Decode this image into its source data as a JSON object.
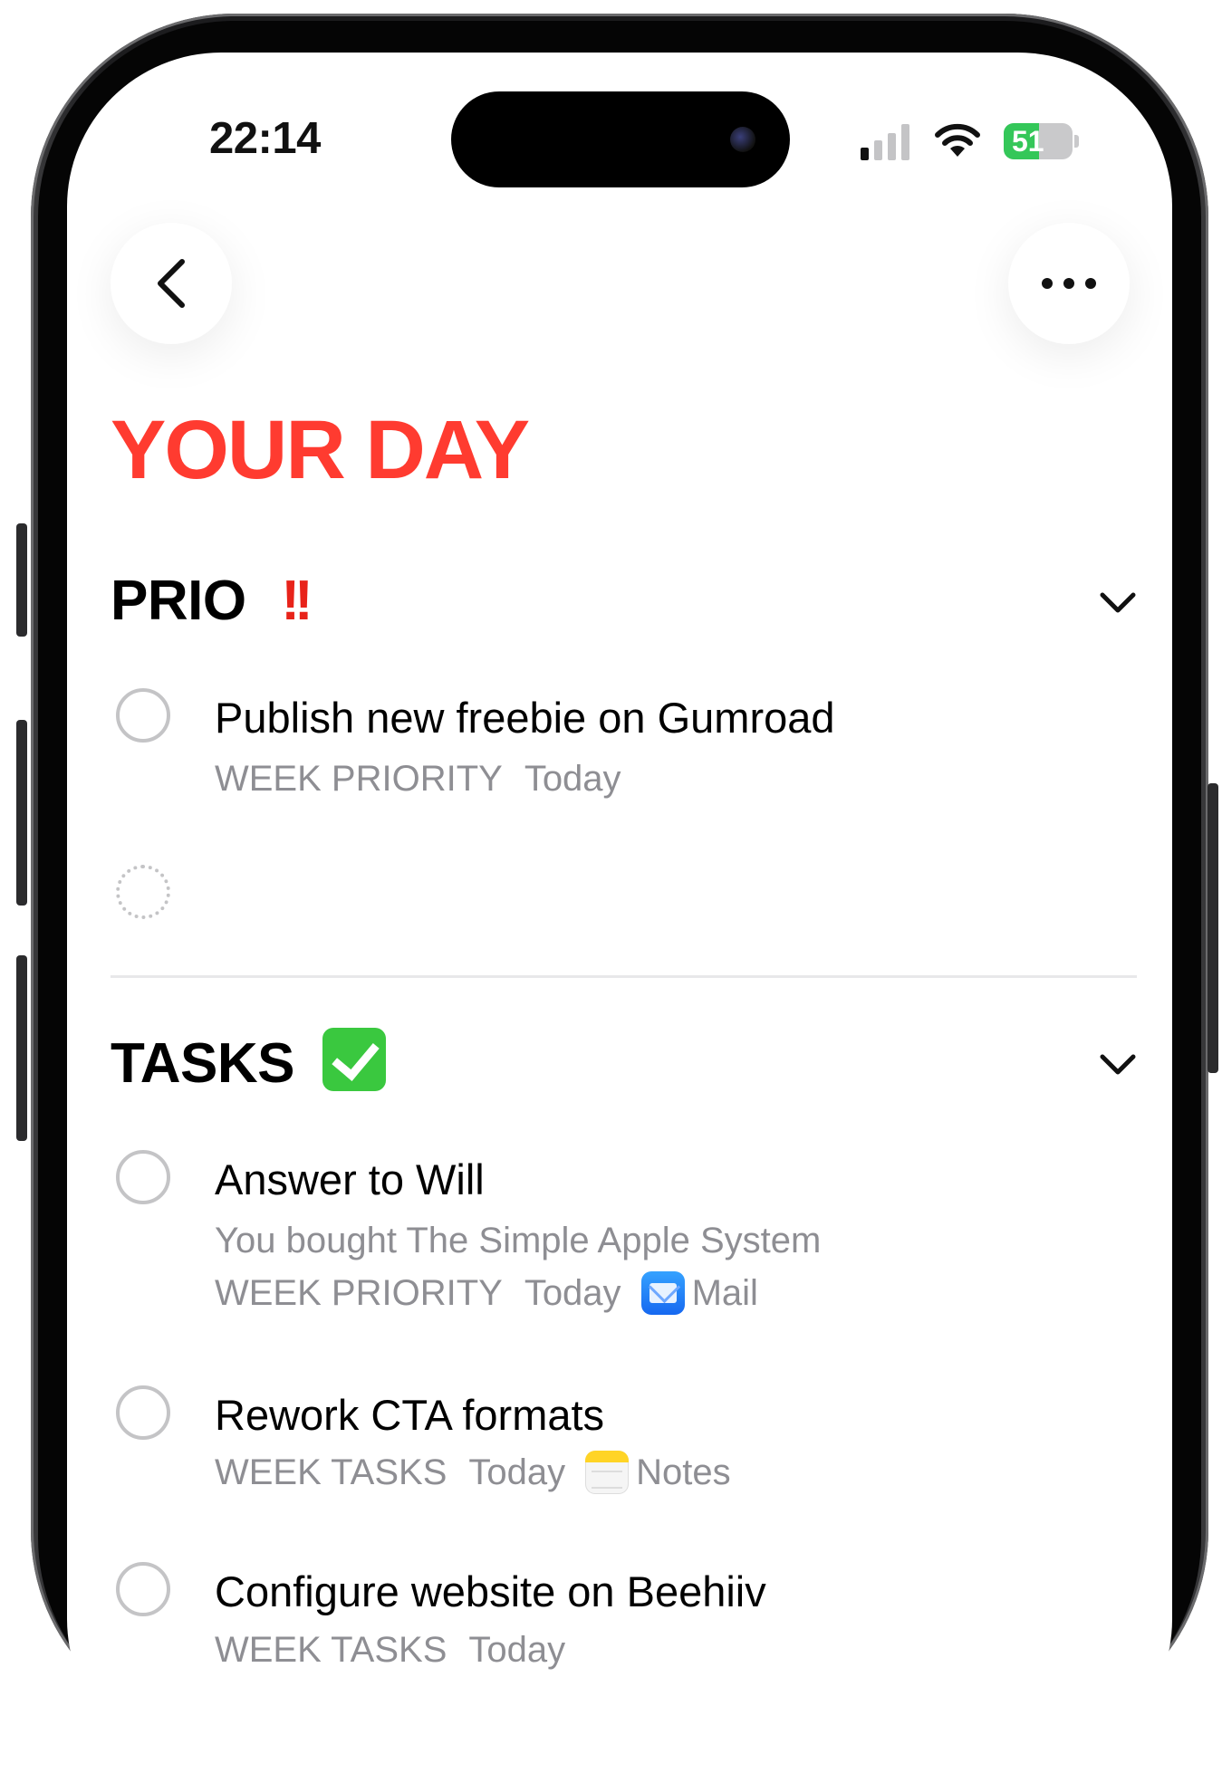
{
  "status_bar": {
    "time": "22:14",
    "battery": "51",
    "battery_level": 0.51
  },
  "header": {
    "back_icon": "chevron-left-icon",
    "more_icon": "ellipsis-icon"
  },
  "page": {
    "title": "YOUR DAY"
  },
  "sections": {
    "prio": {
      "title": "PRIO",
      "emoji": "‼️",
      "tasks": [
        {
          "title": "Publish new freebie on Gumroad",
          "list": "WEEK PRIORITY",
          "due": "Today"
        }
      ]
    },
    "tasks": {
      "title": "TASKS",
      "emoji": "✅",
      "tasks": [
        {
          "title": "Answer to Will",
          "note": "You bought The Simple Apple System",
          "list": "WEEK PRIORITY",
          "due": "Today",
          "app": "Mail",
          "app_icon": "mail-icon"
        },
        {
          "title": "Rework CTA formats",
          "list": "WEEK TASKS",
          "due": "Today",
          "app": "Notes",
          "app_icon": "notes-icon"
        },
        {
          "title": "Configure website on Beehiiv",
          "list": "WEEK TASKS",
          "due": "Today"
        }
      ]
    }
  },
  "colors": {
    "accent": "#ff3b30",
    "meta_text": "#8e8e93",
    "circle": "#c4c4c6"
  }
}
